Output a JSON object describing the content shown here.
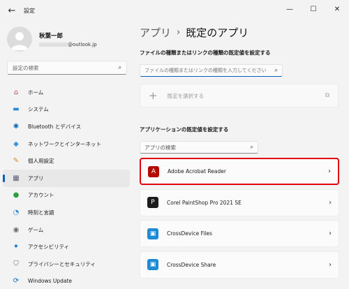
{
  "window": {
    "title": "設定",
    "back_icon": "←",
    "minimize": "—",
    "maximize": "☐",
    "close": "✕"
  },
  "profile": {
    "name": "秋葉一郎",
    "email_suffix": "@outlook.jp"
  },
  "sidebar": {
    "search_placeholder": "設定の検索",
    "items": [
      {
        "label": "ホーム",
        "icon": "home-icon",
        "glyph": "⌂",
        "color": "#c0504d"
      },
      {
        "label": "システム",
        "icon": "system-icon",
        "glyph": "▬",
        "color": "#2b88d8"
      },
      {
        "label": "Bluetooth とデバイス",
        "icon": "bluetooth-icon",
        "glyph": "✱",
        "color": "#0f6cbd"
      },
      {
        "label": "ネットワークとインターネット",
        "icon": "network-icon",
        "glyph": "◆",
        "color": "#3a96dd"
      },
      {
        "label": "個人用設定",
        "icon": "personalization-icon",
        "glyph": "✎",
        "color": "#d98c2a"
      },
      {
        "label": "アプリ",
        "icon": "apps-icon",
        "glyph": "▦",
        "color": "#5b5b7a"
      },
      {
        "label": "アカウント",
        "icon": "accounts-icon",
        "glyph": "●",
        "color": "#2ea043"
      },
      {
        "label": "時刻と言語",
        "icon": "time-language-icon",
        "glyph": "◔",
        "color": "#2b88d8"
      },
      {
        "label": "ゲーム",
        "icon": "gaming-icon",
        "glyph": "◉",
        "color": "#6b6b6b"
      },
      {
        "label": "アクセシビリティ",
        "icon": "accessibility-icon",
        "glyph": "✦",
        "color": "#0f6cbd"
      },
      {
        "label": "プライバシーとセキュリティ",
        "icon": "shield-icon",
        "glyph": "⛉",
        "color": "#6b6b6b"
      },
      {
        "label": "Windows Update",
        "icon": "update-icon",
        "glyph": "⟳",
        "color": "#0f6cbd"
      }
    ],
    "active_index": 5
  },
  "main": {
    "breadcrumb_parent": "アプリ",
    "breadcrumb_sep": "›",
    "breadcrumb_current": "既定のアプリ",
    "file_section_title": "ファイルの種類またはリンクの種類の既定値を設定する",
    "file_input_placeholder": "ファイルの種類またはリンクの種類を入力してください",
    "choose_default_label": "既定を選択する",
    "app_section_title": "アプリケーションの既定値を設定する",
    "app_search_placeholder": "アプリの検索",
    "apps": [
      {
        "name": "Adobe Acrobat Reader",
        "icon": "acrobat-icon",
        "bg": "#b30b00",
        "glyph": "A",
        "highlight": true
      },
      {
        "name": "Corel PaintShop Pro 2021 SE",
        "icon": "paintshop-icon",
        "bg": "#1b1b1b",
        "glyph": "P",
        "highlight": false
      },
      {
        "name": "CrossDevice Files",
        "icon": "crossdevice-files-icon",
        "bg": "#1d8ad8",
        "glyph": "▣",
        "highlight": false
      },
      {
        "name": "CrossDevice Share",
        "icon": "crossdevice-share-icon",
        "bg": "#1d8ad8",
        "glyph": "▣",
        "highlight": false
      }
    ]
  },
  "colors": {
    "accent": "#005fb8",
    "highlight_border": "#e3000f"
  }
}
